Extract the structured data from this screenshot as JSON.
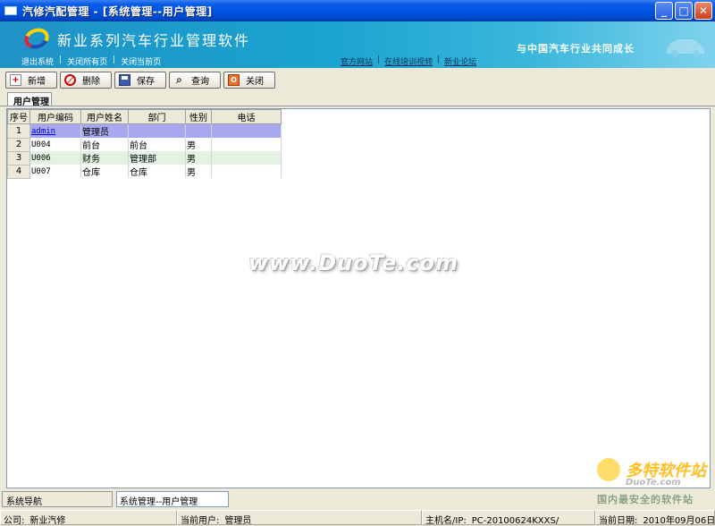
{
  "window": {
    "title": "汽修汽配管理 - [系统管理--用户管理]",
    "minimize": "_",
    "maximize": "□",
    "close": "✕"
  },
  "banner": {
    "title": "新业系列汽车行业管理软件",
    "slogan": "与中国汽车行业共同成长",
    "links_left": [
      "退出系统",
      "关闭所有页",
      "关闭当前页"
    ],
    "links_right": [
      "官方网站",
      "在线培训视频",
      "新业论坛"
    ]
  },
  "toolbar": {
    "new": "新增",
    "delete": "删除",
    "save": "保存",
    "query": "查询",
    "close": "关闭"
  },
  "tab": {
    "label": "用户管理"
  },
  "grid": {
    "columns": [
      "序号",
      "用户编码",
      "用户姓名",
      "部门",
      "性别",
      "电话"
    ],
    "rows": [
      {
        "no": "1",
        "code": "admin",
        "name": "管理员",
        "dept": "",
        "gender": "",
        "phone": ""
      },
      {
        "no": "2",
        "code": "U004",
        "name": "前台",
        "dept": "前台",
        "gender": "男",
        "phone": ""
      },
      {
        "no": "3",
        "code": "U006",
        "name": "财务",
        "dept": "管理部",
        "gender": "男",
        "phone": ""
      },
      {
        "no": "4",
        "code": "U007",
        "name": "仓库",
        "dept": "仓库",
        "gender": "男",
        "phone": ""
      }
    ]
  },
  "watermark": {
    "center": "www.DuoTe.com",
    "corner_brand": "多特软件站",
    "corner_site": "DuoTe.com",
    "corner_tag": "国内最安全的软件站"
  },
  "nav": {
    "label": "系统导航",
    "current": "系统管理--用户管理"
  },
  "status": {
    "company_label": "公司:",
    "company": "新业汽修",
    "user_label": "当前用户:",
    "user": "管理员",
    "host_label": "主机名/IP:",
    "host": "PC-20100624KXXS/",
    "date_label": "当前日期:",
    "date": "2010年09月06日"
  }
}
